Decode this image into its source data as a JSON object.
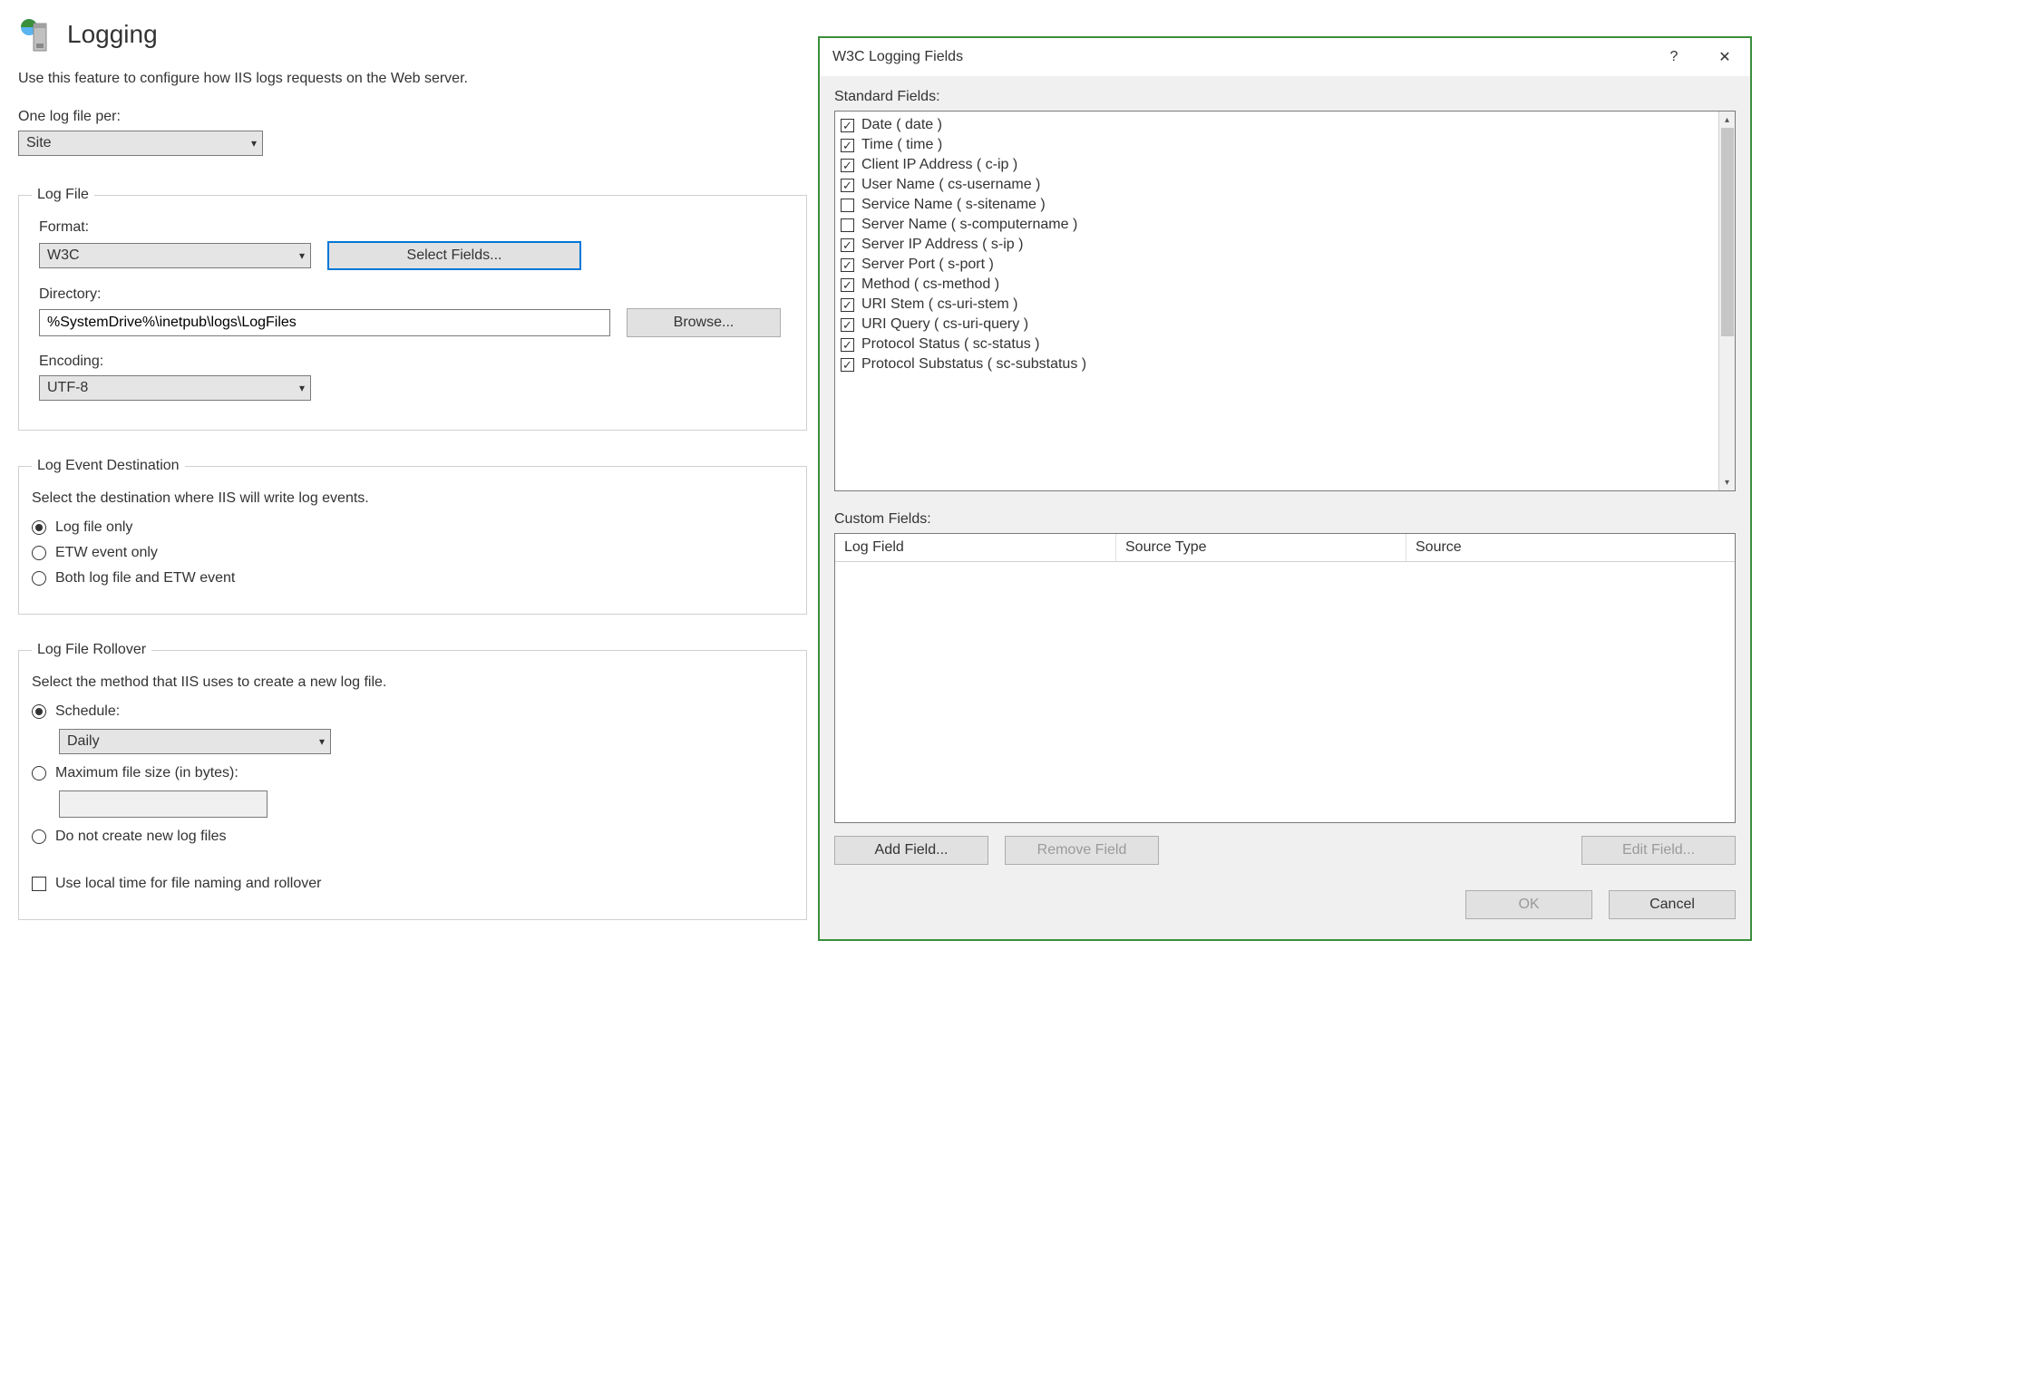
{
  "page": {
    "title": "Logging",
    "description": "Use this feature to configure how IIS logs requests on the Web server."
  },
  "log_file_per": {
    "label": "One log file per:",
    "value": "Site"
  },
  "log_file": {
    "group": "Log File",
    "format_label": "Format:",
    "format_value": "W3C",
    "select_fields_btn": "Select Fields...",
    "directory_label": "Directory:",
    "directory_value": "%SystemDrive%\\inetpub\\logs\\LogFiles",
    "browse_btn": "Browse...",
    "encoding_label": "Encoding:",
    "encoding_value": "UTF-8"
  },
  "destination": {
    "group": "Log Event Destination",
    "hint": "Select the destination where IIS will write log events.",
    "opt1": "Log file only",
    "opt2": "ETW event only",
    "opt3": "Both log file and ETW event"
  },
  "rollover": {
    "group": "Log File Rollover",
    "hint": "Select the method that IIS uses to create a new log file.",
    "schedule_label": "Schedule:",
    "schedule_value": "Daily",
    "maxsize_label": "Maximum file size (in bytes):",
    "nocreate_label": "Do not create new log files",
    "localtime_label": "Use local time for file naming and rollover"
  },
  "dialog": {
    "title": "W3C Logging Fields",
    "help": "?",
    "close": "✕",
    "standard_label": "Standard Fields:",
    "custom_label": "Custom Fields:",
    "columns": {
      "a": "Log Field",
      "b": "Source Type",
      "c": "Source"
    },
    "buttons": {
      "add": "Add Field...",
      "remove": "Remove Field",
      "edit": "Edit Field...",
      "ok": "OK",
      "cancel": "Cancel"
    },
    "standard_fields": [
      {
        "label": "Date ( date )",
        "checked": true
      },
      {
        "label": "Time ( time )",
        "checked": true
      },
      {
        "label": "Client IP Address ( c-ip )",
        "checked": true
      },
      {
        "label": "User Name ( cs-username )",
        "checked": true
      },
      {
        "label": "Service Name ( s-sitename )",
        "checked": false
      },
      {
        "label": "Server Name ( s-computername )",
        "checked": false
      },
      {
        "label": "Server IP Address ( s-ip )",
        "checked": true
      },
      {
        "label": "Server Port ( s-port )",
        "checked": true
      },
      {
        "label": "Method ( cs-method )",
        "checked": true
      },
      {
        "label": "URI Stem ( cs-uri-stem )",
        "checked": true
      },
      {
        "label": "URI Query ( cs-uri-query )",
        "checked": true
      },
      {
        "label": "Protocol Status ( sc-status )",
        "checked": true
      },
      {
        "label": "Protocol Substatus ( sc-substatus )",
        "checked": true
      }
    ]
  }
}
